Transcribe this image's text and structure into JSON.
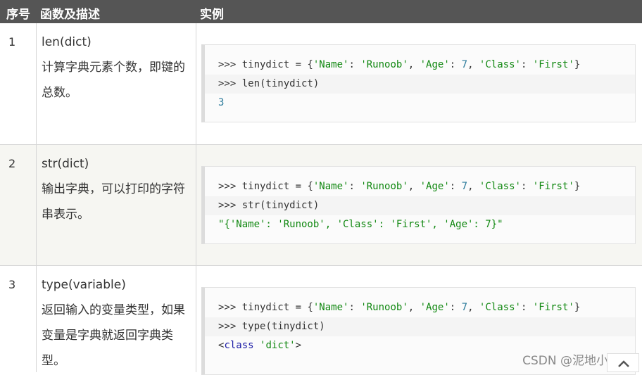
{
  "header": {
    "col_no": "序号",
    "col_func": "函数及描述",
    "col_example": "实例"
  },
  "rows": [
    {
      "no": "1",
      "func": "len(dict)",
      "desc": "计算字典元素个数，即键的总数。",
      "code": {
        "l1_prompt": ">>> ",
        "l1_a": "tinydict = {",
        "l1_s1": "'Name'",
        "l1_c1": ": ",
        "l1_s2": "'Runoob'",
        "l1_c2": ", ",
        "l1_s3": "'Age'",
        "l1_c3": ": ",
        "l1_n1": "7",
        "l1_c4": ", ",
        "l1_s4": "'Class'",
        "l1_c5": ": ",
        "l1_s5": "'First'",
        "l1_end": "}",
        "l2_prompt": ">>> ",
        "l2_text": "len(tinydict)",
        "l3_out": "3"
      }
    },
    {
      "no": "2",
      "func": "str(dict)",
      "desc": "输出字典，可以打印的字符串表示。",
      "code": {
        "l1_prompt": ">>> ",
        "l1_a": "tinydict = {",
        "l1_s1": "'Name'",
        "l1_c1": ": ",
        "l1_s2": "'Runoob'",
        "l1_c2": ", ",
        "l1_s3": "'Age'",
        "l1_c3": ": ",
        "l1_n1": "7",
        "l1_c4": ", ",
        "l1_s4": "'Class'",
        "l1_c5": ": ",
        "l1_s5": "'First'",
        "l1_end": "}",
        "l2_prompt": ">>> ",
        "l2_text": "str(tinydict)",
        "l3_out": "\"{'Name': 'Runoob', 'Class': 'First', 'Age': 7}\""
      }
    },
    {
      "no": "3",
      "func": "type(variable)",
      "desc": "返回输入的变量类型，如果变量是字典就返回字典类型。",
      "code": {
        "l1_prompt": ">>> ",
        "l1_a": "tinydict = {",
        "l1_s1": "'Name'",
        "l1_c1": ": ",
        "l1_s2": "'Runoob'",
        "l1_c2": ", ",
        "l1_s3": "'Age'",
        "l1_c3": ": ",
        "l1_n1": "7",
        "l1_c4": ", ",
        "l1_s4": "'Class'",
        "l1_c5": ": ",
        "l1_s5": "'First'",
        "l1_end": "}",
        "l2_prompt": ">>> ",
        "l2_text": "type(tinydict)",
        "l3_lt": "<",
        "l3_kw": "class",
        "l3_sp": " ",
        "l3_str": "'dict'",
        "l3_gt": ">"
      }
    }
  ],
  "watermark": "CSDN @泥地小白菜",
  "icons": {
    "back_to_top": "chevron-up-icon"
  }
}
